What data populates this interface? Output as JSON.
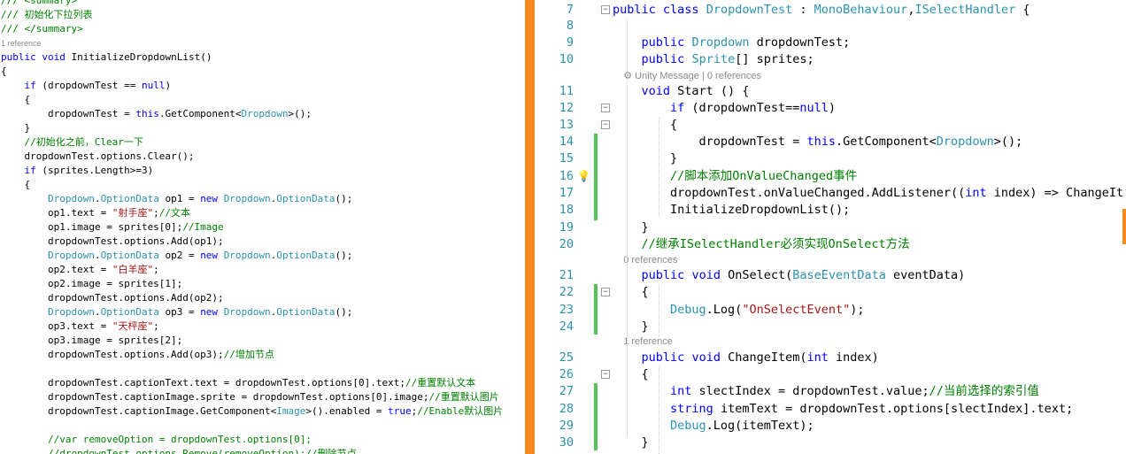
{
  "left_panel": {
    "lines": [
      {
        "text": "/// <summary>",
        "type": "comment"
      },
      {
        "text": "/// 初始化下拉列表",
        "type": "comment"
      },
      {
        "text": "/// </summary>",
        "type": "comment"
      },
      {
        "text": "1 reference",
        "type": "ref"
      },
      {
        "text": "public void InitializeDropdownList()",
        "type": "code"
      },
      {
        "text": "{",
        "type": "code"
      },
      {
        "text": "    if (dropdownTest == null)",
        "type": "code"
      },
      {
        "text": "    {",
        "type": "code"
      },
      {
        "text": "        dropdownTest = this.GetComponent<Dropdown>();",
        "type": "code"
      },
      {
        "text": "    }",
        "type": "code"
      },
      {
        "text": "    //初始化之前，Clear一下",
        "type": "comment"
      },
      {
        "text": "    dropdownTest.options.Clear();",
        "type": "code"
      },
      {
        "text": "    if (sprites.Length>=3)",
        "type": "code"
      },
      {
        "text": "    {",
        "type": "code"
      },
      {
        "text": "        Dropdown.OptionData op1 = new Dropdown.OptionData();",
        "type": "code"
      },
      {
        "text": "        op1.text = \"射手座\";//文本",
        "type": "code"
      },
      {
        "text": "        op1.image = sprites[0];//Image",
        "type": "code"
      },
      {
        "text": "        dropdownTest.options.Add(op1);",
        "type": "code"
      },
      {
        "text": "        Dropdown.OptionData op2 = new Dropdown.OptionData();",
        "type": "code"
      },
      {
        "text": "        op2.text = \"白羊座\";",
        "type": "code"
      },
      {
        "text": "        op2.image = sprites[1];",
        "type": "code"
      },
      {
        "text": "        dropdownTest.options.Add(op2);",
        "type": "code"
      },
      {
        "text": "        Dropdown.OptionData op3 = new Dropdown.OptionData();",
        "type": "code"
      },
      {
        "text": "        op3.text = \"天枰座\";",
        "type": "code"
      },
      {
        "text": "        op3.image = sprites[2];",
        "type": "code"
      },
      {
        "text": "        dropdownTest.options.Add(op3);//增加节点",
        "type": "code"
      },
      {
        "text": "",
        "type": "code"
      },
      {
        "text": "        dropdownTest.captionText.text = dropdownTest.options[0].text;//重置默认文本",
        "type": "code"
      },
      {
        "text": "        dropdownTest.captionImage.sprite = dropdownTest.options[0].image;//重置默认图片",
        "type": "code"
      },
      {
        "text": "        dropdownTest.captionImage.GetComponent<Image>().enabled = true;//Enable默认图片",
        "type": "code"
      },
      {
        "text": "",
        "type": "code"
      },
      {
        "text": "        //var removeOption = dropdownTest.options[0];",
        "type": "comment"
      },
      {
        "text": "        //dropdownTest.options.Remove(removeOption);//删除节点",
        "type": "comment"
      }
    ]
  },
  "right_panel": {
    "lines": [
      {
        "num": "7",
        "text": "public class DropdownTest : MonoBehaviour,ISelectHandler {"
      },
      {
        "num": "8",
        "text": ""
      },
      {
        "num": "9",
        "text": "    public Dropdown dropdownTest;"
      },
      {
        "num": "10",
        "text": "    public Sprite[] sprites;"
      },
      {
        "num": "",
        "text": "    ⚙ Unity Message | 0 references",
        "ref": true
      },
      {
        "num": "11",
        "text": "    void Start () {"
      },
      {
        "num": "12",
        "text": "        if (dropdownTest==null)"
      },
      {
        "num": "13",
        "text": "        {"
      },
      {
        "num": "14",
        "text": "            dropdownTest = this.GetComponent<Dropdown>();"
      },
      {
        "num": "15",
        "text": "        }"
      },
      {
        "num": "16",
        "text": "        //脚本添加OnValueChanged事件"
      },
      {
        "num": "17",
        "text": "        dropdownTest.onValueChanged.AddListener((int index) => ChangeIt"
      },
      {
        "num": "18",
        "text": "        InitializeDropdownList();"
      },
      {
        "num": "19",
        "text": "    }"
      },
      {
        "num": "20",
        "text": "    //继承ISelectHandler必须实现OnSelect方法"
      },
      {
        "num": "",
        "text": "    0 references",
        "ref": true
      },
      {
        "num": "21",
        "text": "    public void OnSelect(BaseEventData eventData)"
      },
      {
        "num": "22",
        "text": "    {"
      },
      {
        "num": "23",
        "text": "        Debug.Log(\"OnSelectEvent\");"
      },
      {
        "num": "24",
        "text": "    }"
      },
      {
        "num": "",
        "text": "    1 reference",
        "ref": true
      },
      {
        "num": "25",
        "text": "    public void ChangeItem(int index)"
      },
      {
        "num": "26",
        "text": "    {"
      },
      {
        "num": "27",
        "text": "        int slectIndex = dropdownTest.value;//当前选择的索引值"
      },
      {
        "num": "28",
        "text": "        string itemText = dropdownTest.options[slectIndex].text;"
      },
      {
        "num": "29",
        "text": "        Debug.Log(itemText);"
      },
      {
        "num": "30",
        "text": "    }"
      }
    ]
  },
  "colors": {
    "keyword": "#0000ff",
    "type": "#2b91af",
    "comment": "#008000",
    "string": "#a31515",
    "linenum": "#2b91af",
    "separator": "#f58a1f",
    "changebar": "#57c15a"
  }
}
